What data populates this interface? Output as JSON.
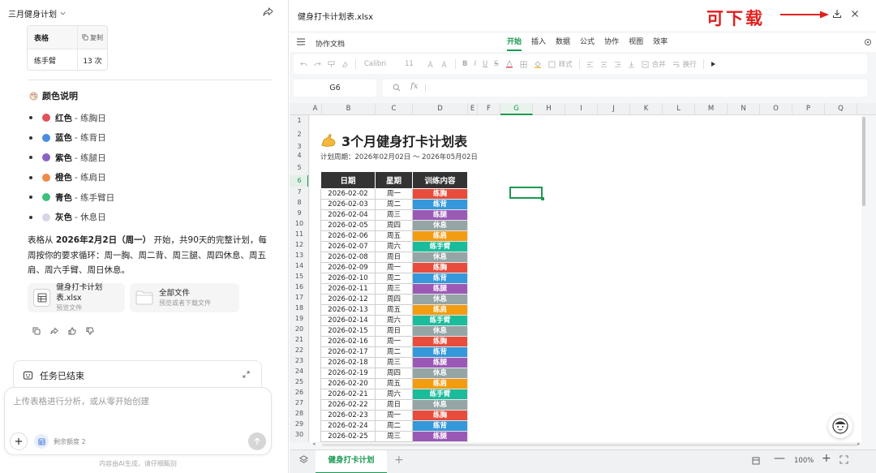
{
  "conversation": {
    "title": "三月健身计划",
    "mini_table": {
      "header": [
        "表格",
        "复制"
      ],
      "row": [
        "练手臂",
        "13 次"
      ]
    },
    "legend_title": "颜色说明",
    "legend": [
      {
        "color_name": "红色",
        "desc": "- 练胸日",
        "color": "#e0525a"
      },
      {
        "color_name": "蓝色",
        "desc": "- 练背日",
        "color": "#4a8de0"
      },
      {
        "color_name": "紫色",
        "desc": "- 练腿日",
        "color": "#8b63c4"
      },
      {
        "color_name": "橙色",
        "desc": "- 练肩日",
        "color": "#f08a4a"
      },
      {
        "color_name": "青色",
        "desc": "- 练手臂日",
        "color": "#3cc07a"
      },
      {
        "color_name": "灰色",
        "desc": "- 休息日",
        "color": "#d0d0e0"
      }
    ],
    "para": {
      "p1": "表格从 ",
      "bold": "2026年2月2日（周一）",
      "p2": " 开始，共90天的完整计划，每周按你的要求循环：周一胸、周二背、周三腿、周四休息、周五肩、周六手臂、周日休息。"
    },
    "files": [
      {
        "name": "健身打卡计划表.xlsx",
        "sub": "预览文件"
      },
      {
        "name": "全部文件",
        "sub": "预览或者下载文件"
      }
    ],
    "task_status": "任务已结束",
    "input_placeholder": "上传表格进行分析，或从零开始创建",
    "quota_text": "剩余额度 2",
    "disclaimer": "内容由AI生成，请仔细甄别"
  },
  "document": {
    "filename": "健身打卡计划表.xlsx",
    "download_note": "可下载",
    "menu": {
      "collab": "协作文档",
      "tabs": [
        "开始",
        "插入",
        "数据",
        "公式",
        "协作",
        "视图",
        "效率"
      ],
      "active_tab": "开始"
    },
    "toolbar": {
      "font": "Calibri",
      "size": "11",
      "style_label": "样式",
      "merge_label": "合并",
      "wrap_label": "换行"
    },
    "name_box": "G6",
    "fx_label": "fx",
    "columns": [
      "A",
      "B",
      "C",
      "D",
      "E",
      "F",
      "G",
      "H",
      "I",
      "J",
      "K",
      "L",
      "M",
      "N",
      "O",
      "P",
      "Q"
    ],
    "selected_column": "G",
    "rows": [
      "1",
      "2",
      "3",
      "4",
      "5",
      "6",
      "7",
      "8",
      "9",
      "10",
      "11",
      "12",
      "13",
      "14",
      "15",
      "16",
      "17",
      "18",
      "19",
      "20",
      "21",
      "22",
      "23",
      "24",
      "25",
      "26",
      "27",
      "28",
      "29",
      "30"
    ],
    "selected_row": "6",
    "sheet_title": "3个月健身打卡计划表",
    "period": "计划周期：2026年02月02日 ～ 2026年05月02日",
    "table_headers": [
      "日期",
      "星期",
      "训练内容"
    ],
    "exercise_colors": {
      "练胸": "#e74c3c",
      "练背": "#3498db",
      "练腿": "#9b59b6",
      "休息": "#95a5a6",
      "练肩": "#f39c12",
      "练手臂": "#1abc9c"
    },
    "table_rows": [
      [
        "2026-02-02",
        "周一",
        "练胸"
      ],
      [
        "2026-02-03",
        "周二",
        "练背"
      ],
      [
        "2026-02-04",
        "周三",
        "练腿"
      ],
      [
        "2026-02-05",
        "周四",
        "休息"
      ],
      [
        "2026-02-06",
        "周五",
        "练肩"
      ],
      [
        "2026-02-07",
        "周六",
        "练手臂"
      ],
      [
        "2026-02-08",
        "周日",
        "休息"
      ],
      [
        "2026-02-09",
        "周一",
        "练胸"
      ],
      [
        "2026-02-10",
        "周二",
        "练背"
      ],
      [
        "2026-02-11",
        "周三",
        "练腿"
      ],
      [
        "2026-02-12",
        "周四",
        "休息"
      ],
      [
        "2026-02-13",
        "周五",
        "练肩"
      ],
      [
        "2026-02-14",
        "周六",
        "练手臂"
      ],
      [
        "2026-02-15",
        "周日",
        "休息"
      ],
      [
        "2026-02-16",
        "周一",
        "练胸"
      ],
      [
        "2026-02-17",
        "周二",
        "练背"
      ],
      [
        "2026-02-18",
        "周三",
        "练腿"
      ],
      [
        "2026-02-19",
        "周四",
        "休息"
      ],
      [
        "2026-02-20",
        "周五",
        "练肩"
      ],
      [
        "2026-02-21",
        "周六",
        "练手臂"
      ],
      [
        "2026-02-22",
        "周日",
        "休息"
      ],
      [
        "2026-02-23",
        "周一",
        "练胸"
      ],
      [
        "2026-02-24",
        "周二",
        "练背"
      ],
      [
        "2026-02-25",
        "周三",
        "练腿"
      ]
    ],
    "sheet_tab": "健身打卡计划",
    "zoom": "100%"
  }
}
